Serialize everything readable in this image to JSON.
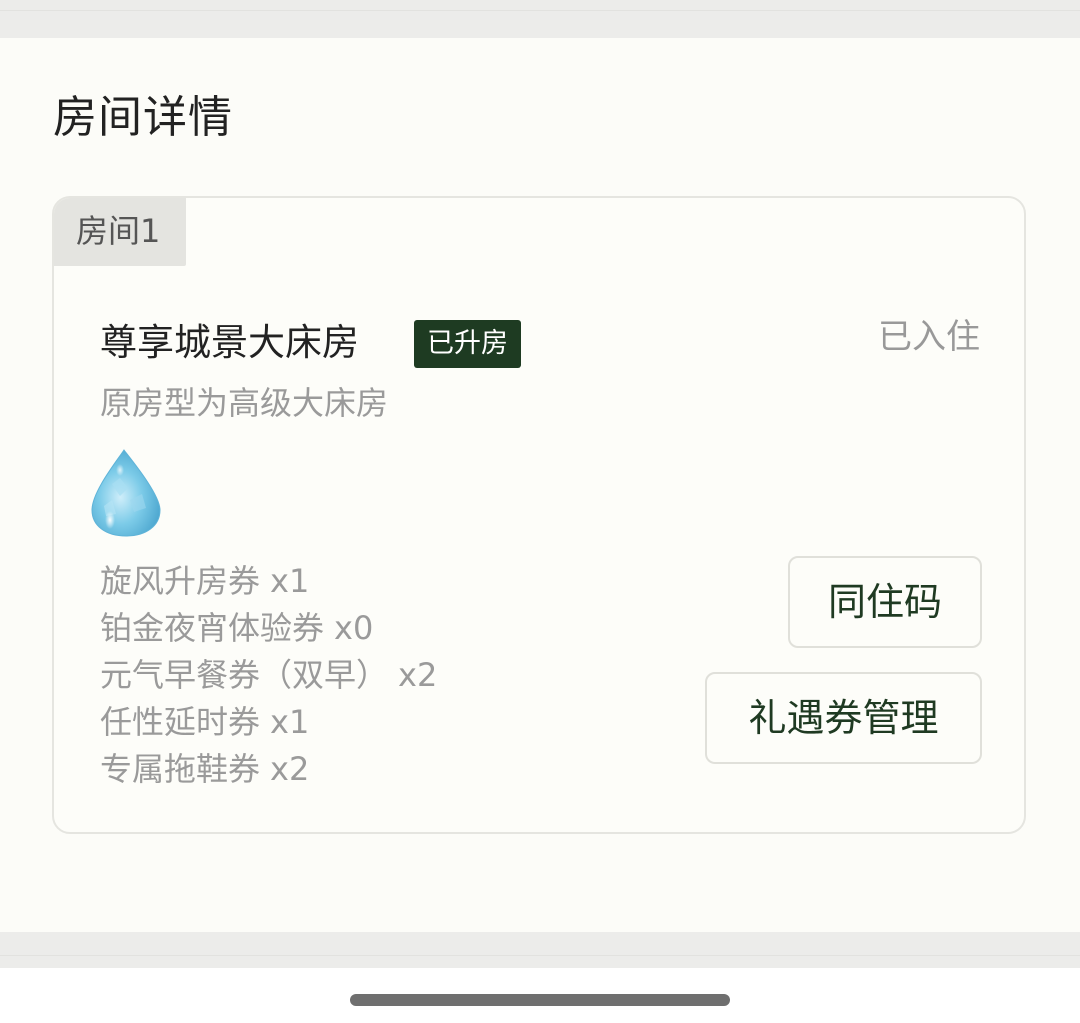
{
  "section_title": "房间详情",
  "room": {
    "tab_label": "房间1",
    "name": "尊享城景大床房",
    "badge": "已升房",
    "status": "已入住",
    "original": "原房型为高级大床房",
    "gem_icon": "blue-water-drop-gem-icon",
    "vouchers": [
      {
        "name": "旋风升房券",
        "qty": "x1"
      },
      {
        "name": "铂金夜宵体验券",
        "qty": "x0"
      },
      {
        "name": "元气早餐券（双早）",
        "qty": "x2"
      },
      {
        "name": "任性延时券",
        "qty": "x1"
      },
      {
        "name": "专属拖鞋券",
        "qty": "x2"
      }
    ],
    "buttons": {
      "cohabit_code": "同住码",
      "voucher_manage": "礼遇券管理"
    }
  },
  "colors": {
    "badge_bg": "#1e3b22",
    "button_text": "#1f3a22",
    "muted_text": "#9a9a9a",
    "page_bg": "#fcfcf8"
  }
}
